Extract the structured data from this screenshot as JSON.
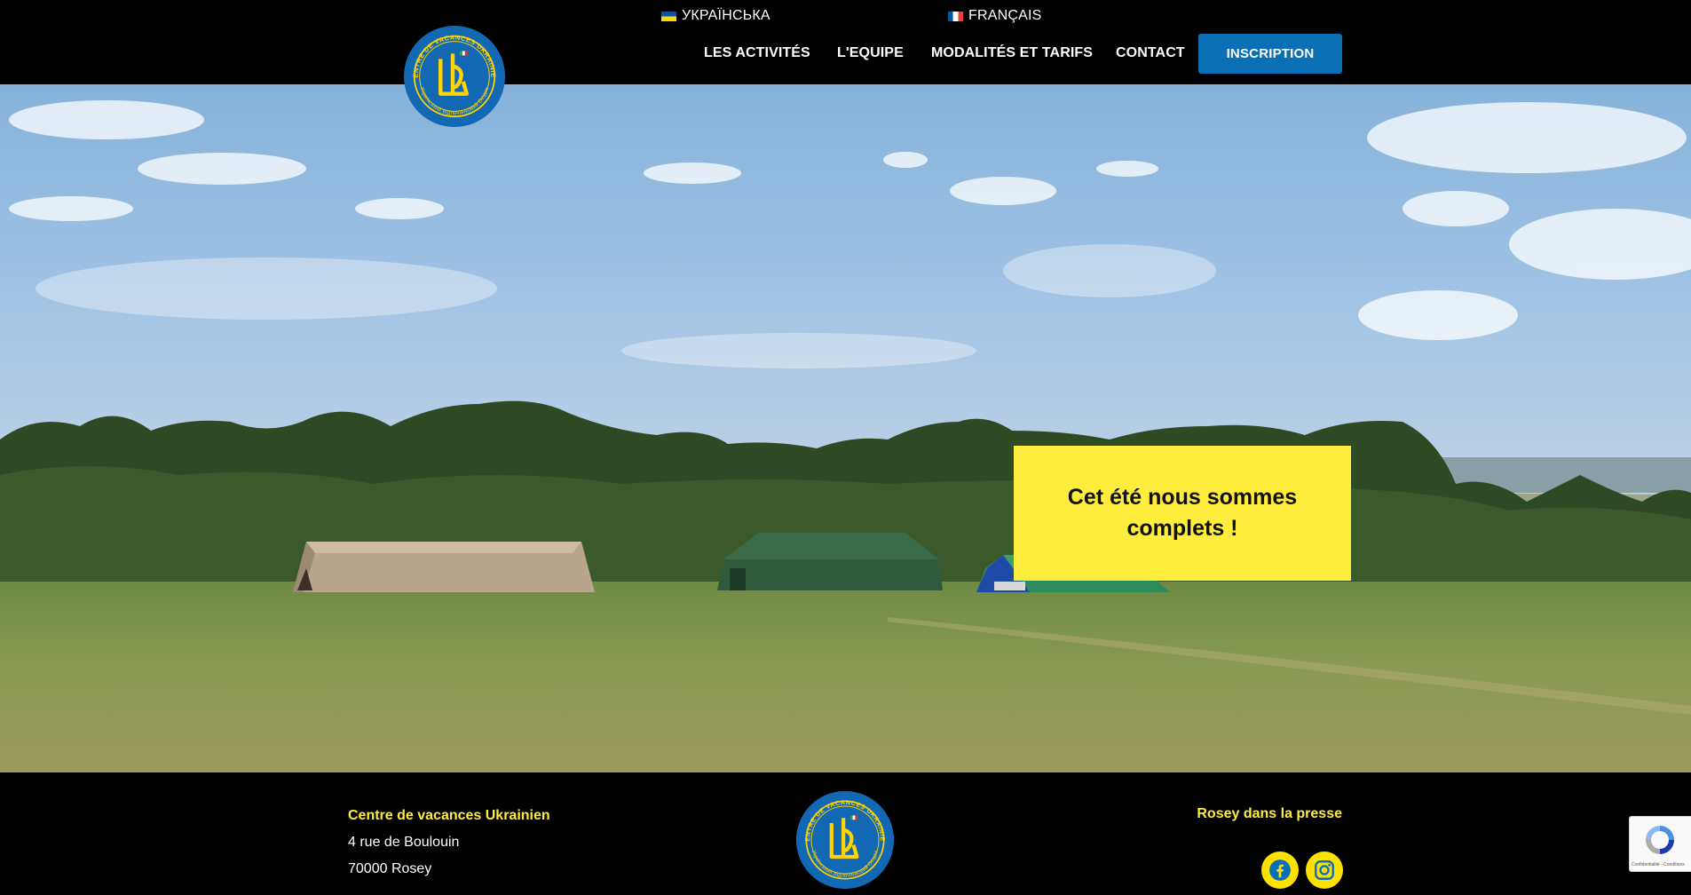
{
  "header": {
    "languages": [
      {
        "label": "УКРАЇНСЬКА",
        "flag": "ua-flag"
      },
      {
        "label": "FRANÇAIS",
        "flag": "fr-flag"
      }
    ],
    "nav": [
      {
        "label": "LES ACTIVITÉS"
      },
      {
        "label": "L'EQUIPE"
      },
      {
        "label": "MODALITÉS ET TARIFS"
      },
      {
        "label": "CONTACT"
      }
    ],
    "cta_label": "INSCRIPTION"
  },
  "hero": {
    "notice": "Cet été nous sommes complets !"
  },
  "footer": {
    "title": "Centre de vacances Ukrainien",
    "address_line1": "4 rue de Boulouin",
    "address_line2": "70000 Rosey",
    "press_link": "Rosey dans la presse",
    "social": [
      {
        "icon": "facebook-icon"
      },
      {
        "icon": "instagram-icon"
      }
    ]
  },
  "logo": {
    "ring_text": "CENTRE DE VACANCES UKRAINIEN",
    "ring_text_bottom": "Український Відпочинковий Осідок"
  },
  "recaptcha": {
    "legal": "Confidentialité - Conditions"
  },
  "colors": {
    "accent_yellow": "#ffed3d",
    "button_blue": "#0a6fb5",
    "logo_blue": "#1268b3",
    "background": "#000000"
  }
}
